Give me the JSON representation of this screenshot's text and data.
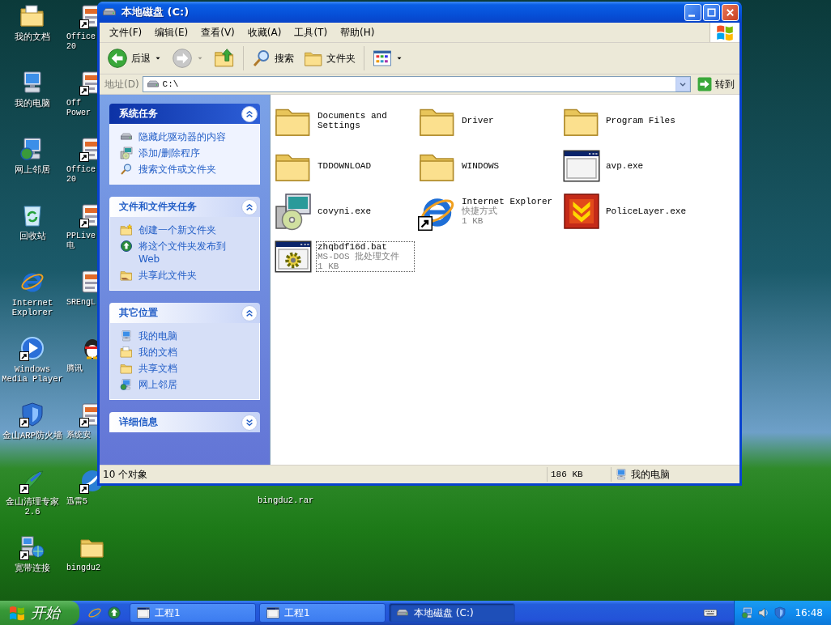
{
  "desktop_icons": [
    {
      "label": "我的文档",
      "kind": "documents",
      "shortcut": false
    },
    {
      "label": "我的电脑",
      "kind": "computer",
      "shortcut": false
    },
    {
      "label": "网上邻居",
      "kind": "network",
      "shortcut": false
    },
    {
      "label": "回收站",
      "kind": "recycle",
      "shortcut": false
    },
    {
      "label": "Internet\nExplorer",
      "kind": "ie",
      "shortcut": false
    },
    {
      "label": "Windows\nMedia Player",
      "kind": "media",
      "shortcut": true
    },
    {
      "label": "金山ARP防火墙",
      "kind": "shield",
      "shortcut": true
    },
    {
      "label": "金山清理专家\n2.6",
      "kind": "cleaner",
      "shortcut": true
    },
    {
      "label": "宽带连接",
      "kind": "broadband",
      "shortcut": true
    },
    {
      "label": "Office\n20",
      "kind": "app",
      "shortcut": true
    },
    {
      "label": "Off\nPower",
      "kind": "app",
      "shortcut": true
    },
    {
      "label": "Office\n20",
      "kind": "app",
      "shortcut": true
    },
    {
      "label": "PPLive\n电",
      "kind": "app",
      "shortcut": true
    },
    {
      "label": "SREngL",
      "kind": "app",
      "shortcut": false
    },
    {
      "label": "腾讯",
      "kind": "qq",
      "shortcut": false
    },
    {
      "label": "系统安",
      "kind": "app",
      "shortcut": true
    },
    {
      "label": "迅雷5",
      "kind": "thunder",
      "shortcut": true
    },
    {
      "label": "bingdu2",
      "kind": "folder",
      "shortcut": false
    }
  ],
  "desktop_file": {
    "label": "bingdu2.rar"
  },
  "window": {
    "title": "本地磁盘 (C:)",
    "menu": [
      "文件(F)",
      "编辑(E)",
      "查看(V)",
      "收藏(A)",
      "工具(T)",
      "帮助(H)"
    ],
    "toolbar": {
      "back": "后退",
      "forward_disabled": true,
      "search": "搜索",
      "folders": "文件夹"
    },
    "address": {
      "label": "地址(D)",
      "value": "C:\\",
      "go": "转到"
    },
    "task_panes": [
      {
        "title": "系统任务",
        "special": true,
        "expanded": true,
        "items": [
          {
            "label": "隐藏此驱动器的内容",
            "kind": "drive"
          },
          {
            "label": "添加/删除程序",
            "kind": "installer"
          },
          {
            "label": "搜索文件或文件夹",
            "kind": "search"
          }
        ]
      },
      {
        "title": "文件和文件夹任务",
        "special": false,
        "expanded": true,
        "items": [
          {
            "label": "创建一个新文件夹",
            "kind": "newfolder"
          },
          {
            "label": "将这个文件夹发布到\nWeb",
            "kind": "globe"
          },
          {
            "label": "共享此文件夹",
            "kind": "share"
          }
        ]
      },
      {
        "title": "其它位置",
        "special": false,
        "expanded": true,
        "items": [
          {
            "label": "我的电脑",
            "kind": "computer"
          },
          {
            "label": "我的文档",
            "kind": "documents"
          },
          {
            "label": "共享文档",
            "kind": "folder"
          },
          {
            "label": "网上邻居",
            "kind": "network"
          }
        ]
      },
      {
        "title": "详细信息",
        "special": false,
        "expanded": false
      }
    ],
    "files": [
      {
        "name": "Documents and Settings",
        "kind": "folder",
        "focused": false
      },
      {
        "name": "Driver",
        "kind": "folder",
        "focused": false
      },
      {
        "name": "Program Files",
        "kind": "folder",
        "focused": false
      },
      {
        "name": "TDDOWNLOAD",
        "kind": "folder",
        "focused": false
      },
      {
        "name": "WINDOWS",
        "kind": "folder",
        "focused": false
      },
      {
        "name": "avp.exe",
        "kind": "window",
        "focused": false
      },
      {
        "name": "covyni.exe",
        "kind": "installer",
        "focused": false
      },
      {
        "name": "Internet Explorer",
        "type": "快捷方式",
        "size": "1 KB",
        "kind": "ie",
        "shortcut": true,
        "focused": false
      },
      {
        "name": "PoliceLayer.exe",
        "kind": "police",
        "focused": false
      },
      {
        "name": "zhqbdf16d.bat",
        "type": "MS-DOS 批处理文件",
        "size": "1 KB",
        "kind": "bat",
        "focused": true
      }
    ],
    "status_bar": {
      "count": "10 个对象",
      "size": "186 KB",
      "zone": "我的电脑"
    }
  },
  "taskbar": {
    "start": "开始",
    "tasks": [
      {
        "label": "工程1",
        "kind": "app",
        "selected": false
      },
      {
        "label": "工程1",
        "kind": "app",
        "selected": false
      },
      {
        "label": "本地磁盘 (C:)",
        "kind": "drive",
        "selected": true
      }
    ],
    "clock": "16:48"
  }
}
